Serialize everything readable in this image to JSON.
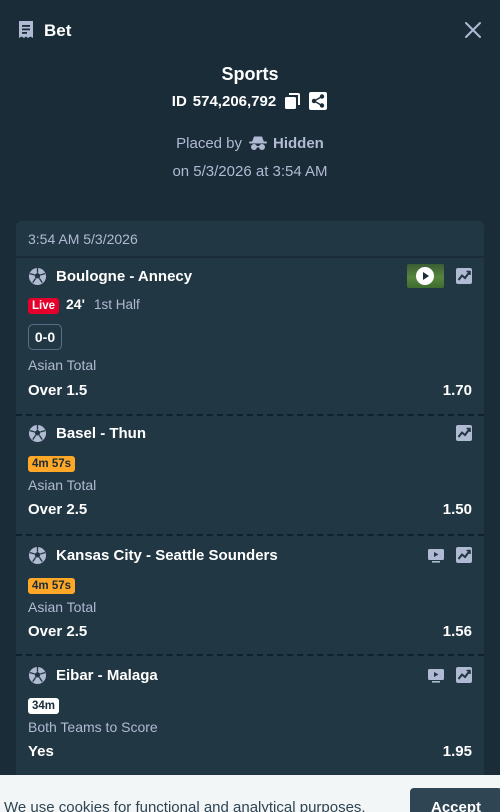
{
  "header": {
    "title": "Bet",
    "icon": "receipt-icon",
    "close_icon": "close-icon"
  },
  "summary": {
    "title": "Sports",
    "id_label": "ID",
    "id_value": "574,206,792",
    "placed_by_label": "Placed by",
    "user": "Hidden",
    "date_line": "on 5/3/2026 at 3:54 AM"
  },
  "bet": {
    "date": "3:54 AM 5/3/2026",
    "legs": [
      {
        "match": "Boulogne - Annecy",
        "live": "Live",
        "minute": "24'",
        "period": "1st Half",
        "score": "0-0",
        "market": "Asian Total",
        "selection": "Over 1.5",
        "odds": "1.70"
      },
      {
        "match": "Basel - Thun",
        "badge": "4m 57s",
        "market": "Asian Total",
        "selection": "Over 2.5",
        "odds": "1.50"
      },
      {
        "match": "Kansas City - Seattle Sounders",
        "badge": "4m 57s",
        "market": "Asian Total",
        "selection": "Over 2.5",
        "odds": "1.56"
      },
      {
        "match": "Eibar - Malaga",
        "badge": "34m",
        "market": "Both Teams to Score",
        "selection": "Yes",
        "odds": "1.95"
      }
    ]
  },
  "cookie": {
    "text": "We use cookies for functional and analytical purposes.",
    "accept_label": "Accept"
  },
  "colors": {
    "background": "#1a2c38",
    "card": "#213743",
    "muted_text": "#b1bad3",
    "live_red": "#e4002b",
    "badge_orange": "#ffa726"
  }
}
